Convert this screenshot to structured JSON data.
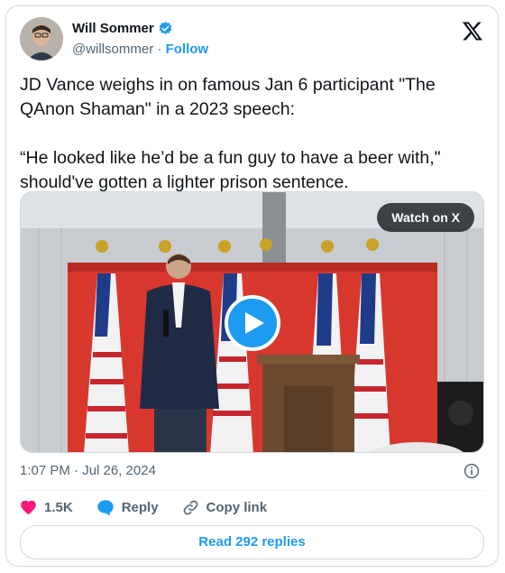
{
  "author": {
    "name": "Will Sommer",
    "handle": "@willsommer",
    "separator": "·",
    "follow_label": "Follow"
  },
  "tweet": {
    "text": "JD Vance weighs in on famous Jan 6 participant \"The QAnon Shaman\" in a 2023 speech:\n\n“He looked like he’d be a fun guy to have a beer with,\" should've gotten a lighter prison sentence."
  },
  "media": {
    "watch_label": "Watch on X"
  },
  "meta": {
    "timestamp": "1:07 PM · Jul 26, 2024"
  },
  "actions": {
    "likes": "1.5K",
    "reply_label": "Reply",
    "copy_label": "Copy link"
  },
  "footer": {
    "read_replies_label": "Read 292 replies"
  },
  "colors": {
    "accent": "#1d9bf0",
    "like": "#f91880",
    "muted": "#536471"
  }
}
